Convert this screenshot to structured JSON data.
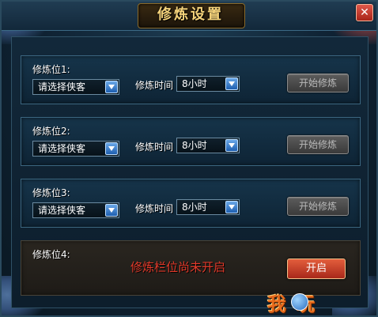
{
  "window": {
    "title": "修炼设置",
    "close_glyph": "✕"
  },
  "slots": [
    {
      "label": "修炼位1:",
      "hero_select": "请选择侠客",
      "time_label": "修炼时间",
      "time_select": "8小时",
      "start_button": "开始修炼"
    },
    {
      "label": "修炼位2:",
      "hero_select": "请选择侠客",
      "time_label": "修炼时间",
      "time_select": "8小时",
      "start_button": "开始修炼"
    },
    {
      "label": "修炼位3:",
      "hero_select": "请选择侠客",
      "time_label": "修炼时间",
      "time_select": "8小时",
      "start_button": "开始修炼"
    },
    {
      "label": "修炼位4:",
      "locked_text": "修炼栏位尚未开启",
      "open_button": "开启"
    }
  ],
  "watermark": {
    "text": "我 玩"
  },
  "colors": {
    "title": "#f4d27a",
    "locked_text": "#e23a2a",
    "open_button": "#c43a22",
    "start_button_disabled": "#4a4a4a"
  }
}
